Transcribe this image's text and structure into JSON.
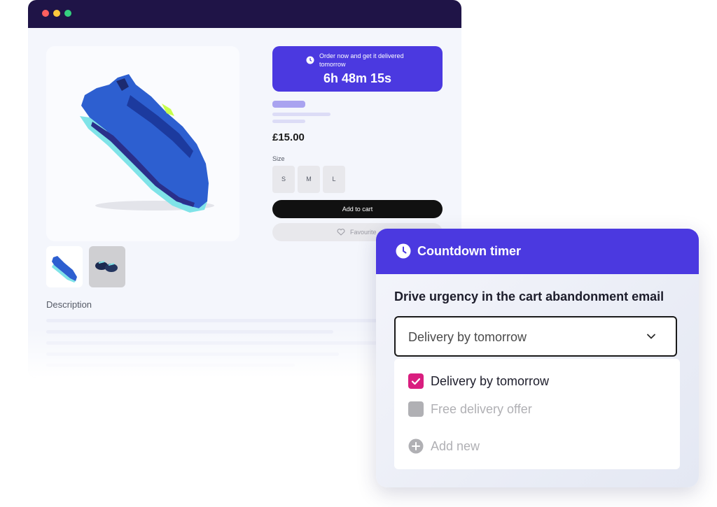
{
  "colors": {
    "accent": "#4b39e0",
    "browser_bar": "#1f1447",
    "checkbox_checked": "#d91e7f",
    "muted": "#b0b0b4"
  },
  "product_page": {
    "timer_banner": {
      "icon": "clock-icon",
      "text": "Order now and get it delivered tomorrow",
      "countdown": "6h 48m 15s"
    },
    "price": "£15.00",
    "size_label": "Size",
    "sizes": [
      "S",
      "M",
      "L"
    ],
    "add_to_cart": "Add to cart",
    "favourite": "Favourite",
    "description_label": "Description"
  },
  "countdown_panel": {
    "title": "Countdown timer",
    "heading": "Drive urgency in the cart abandonment email",
    "dropdown_value": "Delivery by tomorrow",
    "options": [
      {
        "label": "Delivery by tomorrow",
        "checked": true
      },
      {
        "label": "Free delivery offer",
        "checked": false
      }
    ],
    "add_new": "Add new"
  }
}
